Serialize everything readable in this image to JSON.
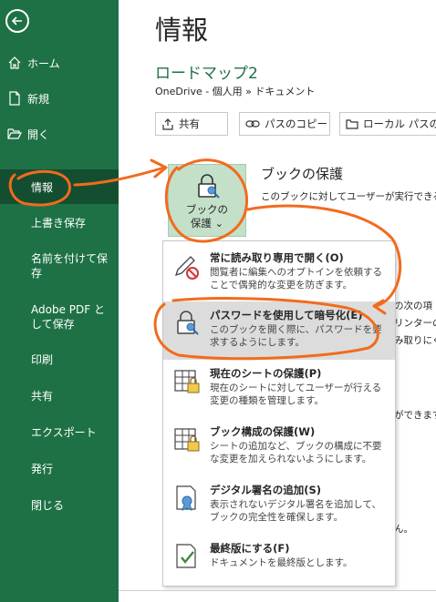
{
  "sidebar": {
    "items": [
      {
        "label": "ホーム",
        "icon": "home-icon"
      },
      {
        "label": "新規",
        "icon": "new-document-icon"
      },
      {
        "label": "開く",
        "icon": "folder-open-icon"
      },
      {
        "label": "情報"
      },
      {
        "label": "上書き保存"
      },
      {
        "label": "名前を付けて保存"
      },
      {
        "label": "Adobe PDF として保存"
      },
      {
        "label": "印刷"
      },
      {
        "label": "共有"
      },
      {
        "label": "エクスポート"
      },
      {
        "label": "発行"
      },
      {
        "label": "閉じる"
      }
    ],
    "selected": "情報",
    "colors": {
      "background": "#1e7145",
      "selected": "#144e30"
    }
  },
  "main": {
    "title": "情報",
    "doc_name": "ロードマップ2",
    "doc_path": "OneDrive - 個人用 » ドキュメント",
    "buttons": [
      {
        "label": "共有",
        "icon": "share-icon"
      },
      {
        "label": "パスのコピー",
        "icon": "link-icon"
      },
      {
        "label": "ローカル パスの",
        "icon": "folder-icon"
      }
    ],
    "protect": {
      "button_label_line1": "ブックの",
      "button_label_line2": "保護 ⌄",
      "title": "ブックの保護",
      "desc": "このブックに対してユーザーが実行できる変"
    },
    "background_fragments": [
      "の次の項",
      "リンターの",
      "み取りにく",
      "ができます",
      "ん。"
    ]
  },
  "dropdown": {
    "items": [
      {
        "title": "常に読み取り専用で開く(O)",
        "desc": "閲覧者に編集へのオプトインを依頼することで偶発的な変更を防ぎます。",
        "icon": "pencil-prohibited-icon"
      },
      {
        "title": "パスワードを使用して暗号化(E)",
        "desc": "このブックを開く際に、パスワードを要求するようにします。",
        "icon": "lock-key-icon",
        "highlighted": true
      },
      {
        "title": "現在のシートの保護(P)",
        "desc": "現在のシートに対してユーザーが行える変更の種類を管理します。",
        "icon": "sheet-lock-icon"
      },
      {
        "title": "ブック構成の保護(W)",
        "desc": "シートの追加など、ブックの構成に不要な変更を加えられないようにします。",
        "icon": "workbook-structure-icon"
      },
      {
        "title": "デジタル署名の追加(S)",
        "desc": "表示されないデジタル署名を追加して、ブックの完全性を確保します。",
        "icon": "digital-signature-icon"
      },
      {
        "title": "最終版にする(F)",
        "desc": "ドキュメントを最終版とします。",
        "icon": "mark-final-icon"
      }
    ],
    "highlight_color": "#dcdcdc"
  },
  "annotation_color": "#f26b1d"
}
